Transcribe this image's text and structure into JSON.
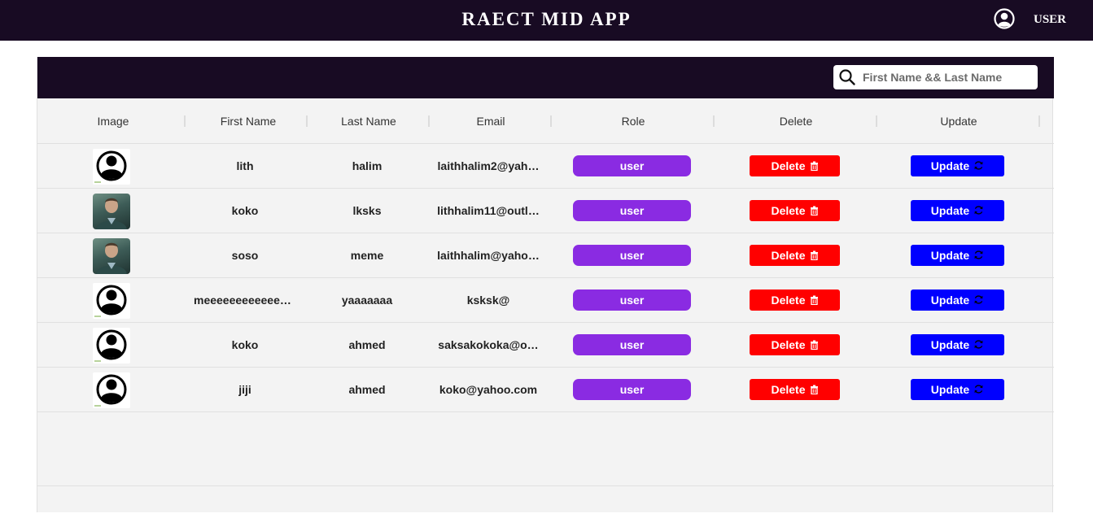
{
  "header": {
    "title": "RAECT MID APP",
    "user_label": "USER"
  },
  "search": {
    "placeholder": "First Name && Last Name"
  },
  "columns": [
    "Image",
    "First Name",
    "Last Name",
    "Email",
    "Role",
    "Delete",
    "Update"
  ],
  "rows": [
    {
      "avatar": "default-avatar",
      "first": "lith",
      "last": "halim",
      "email": "laithhalim2@yah…",
      "role": "user",
      "delete": "Delete",
      "update": "Update"
    },
    {
      "avatar": "photo-avatar",
      "first": "koko",
      "last": "lksks",
      "email": "lithhalim11@outl…",
      "role": "user",
      "delete": "Delete",
      "update": "Update"
    },
    {
      "avatar": "photo-avatar",
      "first": "soso",
      "last": "meme",
      "email": "laithhalim@yaho…",
      "role": "user",
      "delete": "Delete",
      "update": "Update"
    },
    {
      "avatar": "default-avatar",
      "first": "meeeeeeeeeeeee…",
      "last": "yaaaaaaa",
      "email": "ksksk@",
      "role": "user",
      "delete": "Delete",
      "update": "Update"
    },
    {
      "avatar": "default-avatar",
      "first": "koko",
      "last": "ahmed",
      "email": "saksakokoka@o…",
      "role": "user",
      "delete": "Delete",
      "update": "Update"
    },
    {
      "avatar": "default-avatar",
      "first": "jiji",
      "last": "ahmed",
      "email": "koko@yahoo.com",
      "role": "user",
      "delete": "Delete",
      "update": "Update"
    }
  ],
  "colors": {
    "navbar": "#180b23",
    "role": "#8a2be2",
    "delete": "#ff0000",
    "update": "#0000ff",
    "grid_bg": "#f3f3f3"
  },
  "icons": {
    "user": "account-circle-icon",
    "search": "search-icon",
    "delete": "trash-icon",
    "update": "refresh-icon"
  }
}
